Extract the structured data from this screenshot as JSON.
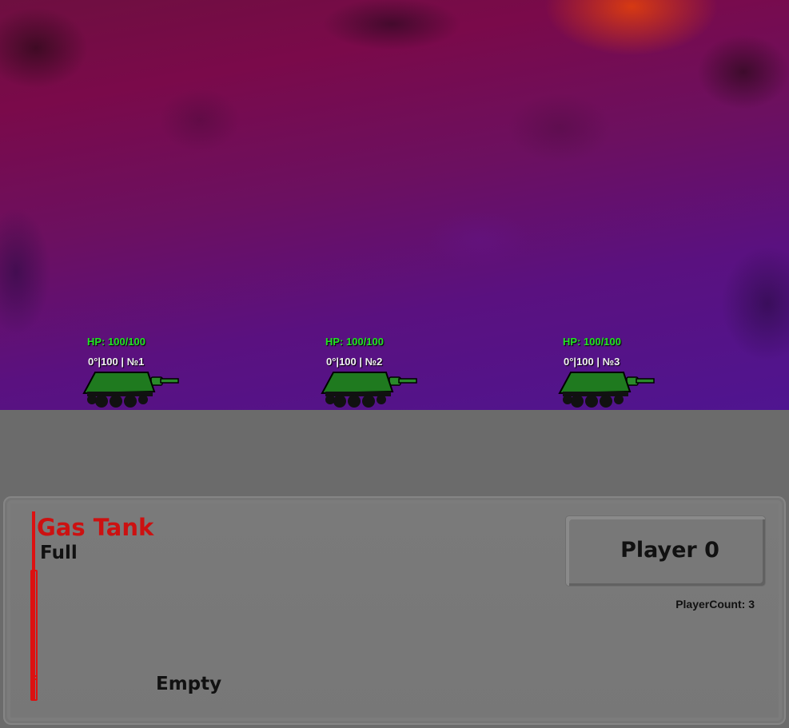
{
  "tanks": [
    {
      "hp": "HP: 100/100",
      "info": "0°|100 | №1"
    },
    {
      "hp": "HP: 100/100",
      "info": "0°|100 | №2"
    },
    {
      "hp": "HP: 100/100",
      "info": "0°|100 | №3"
    }
  ],
  "gas": {
    "title": "Gas Tank",
    "full": "Full",
    "empty": "Empty"
  },
  "player": {
    "label": "Player 0",
    "count": "PlayerCount: 3"
  },
  "colors": {
    "hp": "#22e322",
    "tank_body": "#1f7a1f",
    "gas_title": "#cc1111",
    "panel": "#6b6b6b"
  }
}
